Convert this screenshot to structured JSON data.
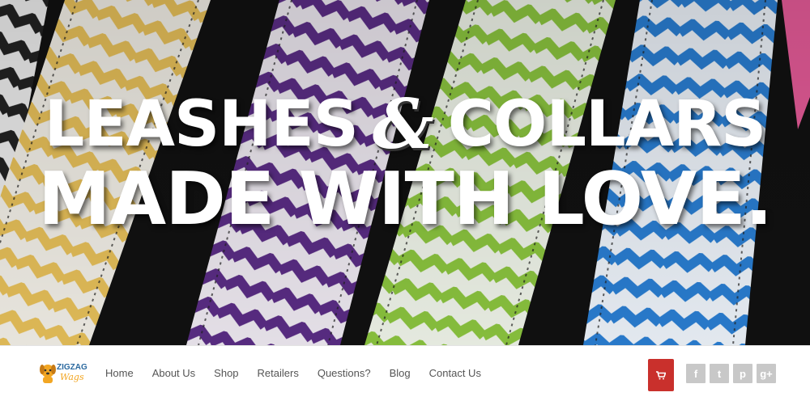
{
  "hero": {
    "line1_left": "LEASHES",
    "ampersand": "&",
    "line1_right": "COLLARS",
    "line2": "MADE WITH LOVE."
  },
  "logo": {
    "line1": "ZIGZAG",
    "line2": "Wags"
  },
  "nav": {
    "items": [
      {
        "label": "Home"
      },
      {
        "label": "About Us"
      },
      {
        "label": "Shop"
      },
      {
        "label": "Retailers"
      },
      {
        "label": "Questions?"
      },
      {
        "label": "Blog"
      },
      {
        "label": "Contact Us"
      }
    ]
  },
  "cart": {
    "icon": "shopping-cart-icon",
    "color": "#c9302c"
  },
  "social": [
    {
      "icon": "facebook-icon",
      "glyph": "f"
    },
    {
      "icon": "twitter-icon",
      "glyph": "t"
    },
    {
      "icon": "pinterest-icon",
      "glyph": "p"
    },
    {
      "icon": "google-plus-icon",
      "glyph": "g+"
    }
  ],
  "colors": {
    "yellow": "#e8c15a",
    "purple": "#5b2d86",
    "green": "#8cc63f",
    "blue": "#2a7fd4",
    "pink": "#e85c9a"
  }
}
